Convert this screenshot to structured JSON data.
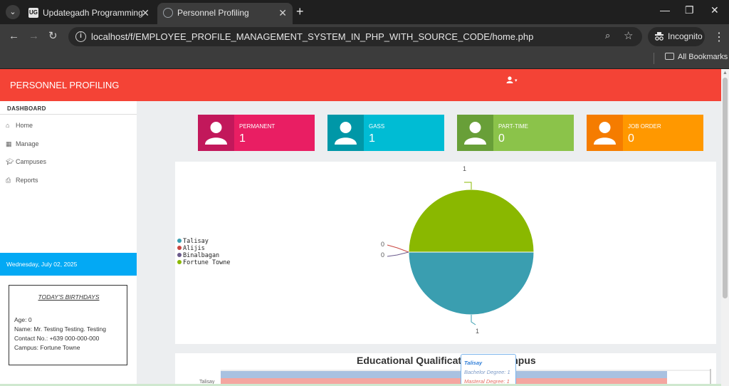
{
  "browser": {
    "tabs": [
      {
        "title": "Updategadh Programming - Up",
        "favicon": "UG"
      },
      {
        "title": "Personnel Profiling"
      }
    ],
    "url": "localhost/f/EMPLOYEE_PROFILE_MANAGEMENT_SYSTEM_IN_PHP_WITH_SOURCE_CODE/home.php",
    "incognito_label": "Incognito",
    "bookmarks_label": "All Bookmarks"
  },
  "header": {
    "brand": "PERSONNEL PROFILING",
    "accent": "#f44336"
  },
  "sidebar": {
    "heading": "DASHBOARD",
    "items": [
      {
        "label": "Home",
        "icon": "home-icon"
      },
      {
        "label": "Manage",
        "icon": "grid-icon"
      },
      {
        "label": "Campuses",
        "icon": "graduation-cap-icon"
      },
      {
        "label": "Reports",
        "icon": "printer-icon"
      }
    ],
    "date": "Wednesday, July 02, 2025"
  },
  "birthdays": {
    "title": "TODAY'S BIRTHDAYS",
    "age": "Age: 0",
    "name": "Name: Mr. Testing Testing. Testing",
    "contact": "Contact No.: +639 000-000-000",
    "campus": "Campus: Fortune Towne"
  },
  "cards": [
    {
      "label": "PERMANENT",
      "value": "1",
      "color": "#e91e63",
      "iconColor": "#c2185b"
    },
    {
      "label": "GASS",
      "value": "1",
      "color": "#00bcd4",
      "iconColor": "#0097a7"
    },
    {
      "label": "PART-TIME",
      "value": "0",
      "color": "#8bc34a",
      "iconColor": "#689f38"
    },
    {
      "label": "JOB ORDER",
      "value": "0",
      "color": "#ff9800",
      "iconColor": "#f57c00"
    }
  ],
  "chart_data": [
    {
      "type": "pie",
      "categories": [
        "Talisay",
        "Alijis",
        "Binalbagan",
        "Fortune Towne"
      ],
      "values": [
        1,
        0,
        0,
        1
      ],
      "colors": [
        "#3a9eb0",
        "#c9453f",
        "#6a5a8c",
        "#8ab800"
      ],
      "legend": "left",
      "data_labels": [
        "1",
        "0",
        "0",
        "1"
      ]
    },
    {
      "type": "bar",
      "title": "Educational Qualificat... Per Campus",
      "categories": [
        "Talisay"
      ],
      "series": [
        {
          "name": "Bachelor Degree",
          "values": [
            1
          ]
        },
        {
          "name": "Masteral Degree",
          "values": [
            1
          ]
        }
      ],
      "tooltip": {
        "title": "Talisay",
        "rows": [
          "Bachelor Degree: 1",
          "Masteral Degree: 1"
        ]
      }
    }
  ]
}
